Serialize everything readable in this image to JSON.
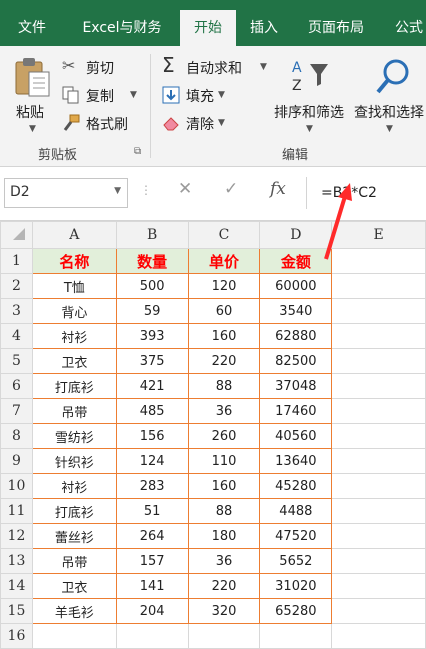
{
  "tabs": [
    {
      "label": "文件",
      "active": false
    },
    {
      "label": "Excel与财务",
      "active": false
    },
    {
      "label": "开始",
      "active": true
    },
    {
      "label": "插入",
      "active": false
    },
    {
      "label": "页面布局",
      "active": false
    },
    {
      "label": "公式",
      "active": false
    }
  ],
  "ribbon": {
    "clipboard": {
      "paste": "粘贴",
      "cut": "剪切",
      "copy": "复制",
      "format_painter": "格式刷",
      "group": "剪贴板"
    },
    "editing": {
      "autosum": "自动求和",
      "fill": "填充",
      "clear": "清除",
      "sort_filter": "排序和筛选",
      "find_select": "查找和选择",
      "group": "编辑"
    }
  },
  "formula_bar": {
    "name_box": "D2",
    "formula": "=B2*C2"
  },
  "sheet": {
    "columns": [
      "A",
      "B",
      "C",
      "D",
      "E"
    ],
    "header_row": [
      "名称",
      "数量",
      "单价",
      "金额"
    ],
    "rows": [
      [
        "T恤",
        "500",
        "120",
        "60000"
      ],
      [
        "背心",
        "59",
        "60",
        "3540"
      ],
      [
        "衬衫",
        "393",
        "160",
        "62880"
      ],
      [
        "卫衣",
        "375",
        "220",
        "82500"
      ],
      [
        "打底衫",
        "421",
        "88",
        "37048"
      ],
      [
        "吊带",
        "485",
        "36",
        "17460"
      ],
      [
        "雪纺衫",
        "156",
        "260",
        "40560"
      ],
      [
        "针织衫",
        "124",
        "110",
        "13640"
      ],
      [
        "衬衫",
        "283",
        "160",
        "45280"
      ],
      [
        "打底衫",
        "51",
        "88",
        "4488"
      ],
      [
        "蕾丝衫",
        "264",
        "180",
        "47520"
      ],
      [
        "吊带",
        "157",
        "36",
        "5652"
      ],
      [
        "卫衣",
        "141",
        "220",
        "31020"
      ],
      [
        "羊毛衫",
        "204",
        "320",
        "65280"
      ]
    ],
    "row_numbers": [
      "1",
      "2",
      "3",
      "4",
      "5",
      "6",
      "7",
      "8",
      "9",
      "10",
      "11",
      "12",
      "13",
      "14",
      "15",
      "16"
    ]
  },
  "colors": {
    "ribbon_green": "#217346",
    "header_fill": "#e2efda",
    "header_text": "#ff0000",
    "border": "#ed7d31",
    "annotation_arrow": "#ff2a2a"
  }
}
